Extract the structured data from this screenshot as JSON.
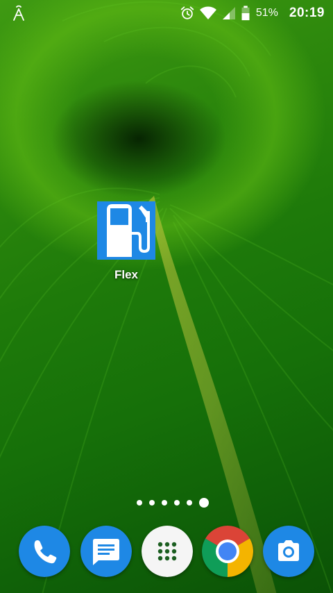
{
  "status_bar": {
    "left_icon": "signal-antenna-icon",
    "icons": [
      "alarm-icon",
      "wifi-icon",
      "cell-signal-icon",
      "battery-icon"
    ],
    "battery_percent": "51%",
    "time": "20:19"
  },
  "home_screen": {
    "apps": [
      {
        "label": "Flex",
        "icon": "fuel-pump-icon",
        "icon_bg": "#1e88e5"
      }
    ],
    "page_indicator": {
      "pages": 6,
      "active_index": 5
    }
  },
  "dock": {
    "items": [
      {
        "name": "phone",
        "icon": "phone-icon",
        "color": "#1e88e5"
      },
      {
        "name": "messages",
        "icon": "message-icon",
        "color": "#1e88e5"
      },
      {
        "name": "app-drawer",
        "icon": "apps-grid-icon",
        "color": "#ffffff"
      },
      {
        "name": "chrome",
        "icon": "chrome-icon",
        "color": "#db4437"
      },
      {
        "name": "camera",
        "icon": "camera-icon",
        "color": "#1e88e5"
      }
    ]
  },
  "colors": {
    "wallpaper_primary": "#1e7a0a",
    "accent_blue": "#1e88e5"
  }
}
